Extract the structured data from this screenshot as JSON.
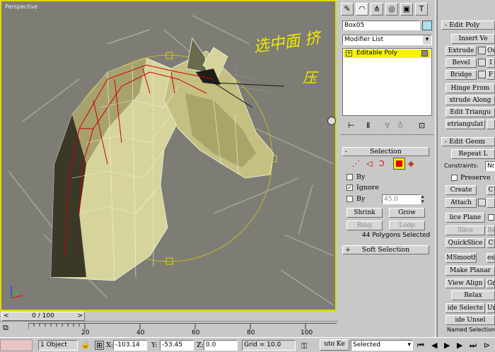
{
  "viewport": {
    "label": "Perspective",
    "annotation_line1": "选中面 挤",
    "annotation_line2": "压"
  },
  "command_panel": {
    "tabs": [
      "create-icon",
      "modify-icon",
      "hierarchy-icon",
      "motion-icon",
      "display-icon",
      "utilities-icon"
    ],
    "object_name": "Box05",
    "modifier_list": "Modifier List",
    "stack_item": "Editable Poly",
    "stack_toolbar_icons": [
      "pin-stack-icon",
      "show-end-result-icon",
      "make-unique-icon",
      "remove-modifier-icon",
      "configure-sets-icon"
    ]
  },
  "selection": {
    "title": "Selection",
    "by_vertex_label": "By",
    "ignore_label": "Ignore",
    "by_angle_label": "By",
    "angle_value": "45.0",
    "shrink": "Shrink",
    "grow": "Grow",
    "ring": "Ring",
    "loop": "Loop",
    "status": "44 Polygons Selected",
    "soft_selection": "Soft Selection"
  },
  "edit_poly": {
    "title": "Edit Poly",
    "insert": "Insert Ve",
    "extrude": "Extrude",
    "outline": "Ou",
    "bevel": "Bevel",
    "inset": "I",
    "bridge": "Bridge",
    "flip": "F",
    "hinge": "Hinge From",
    "extrude_along": "xtrude Along",
    "edit_tri": "Edit Triangu",
    "retriangulate": "etriangulat"
  },
  "edit_geom": {
    "title": "Edit Geom",
    "repeat": "Repeat L",
    "constraints": "Constraints:",
    "constraints_value": "No",
    "preserve": "Preserve",
    "create": "Create",
    "collapse": "C",
    "attach": "Attach",
    "slice_plane": "lice Plane",
    "slice": "Slice",
    "reset": "Re",
    "quickslice": "QuickSlice",
    "cut": "C",
    "msmooth": "MSmooth",
    "tessellate": "es",
    "make_planar": "Make Planar",
    "view_align": "View Align",
    "grid_align": "Gr",
    "relax": "Relax",
    "hide_selected": "ide Selecte",
    "unhide": "Unl",
    "hide_unselected": "ide Unsel",
    "named_selections": "Named Selections:"
  },
  "timeline": {
    "frame": "0 / 100",
    "ticks": [
      "20",
      "40",
      "60",
      "80",
      "100"
    ]
  },
  "status": {
    "objects": "1 Object",
    "x_label": "X:",
    "x_value": "-103.14",
    "y_label": "Y:",
    "y_value": "-53.45",
    "z_label": "Z:",
    "z_value": "0.0",
    "grid": "Grid = 10.0",
    "auto_key": "uto Ke",
    "selected": "Selected"
  },
  "colors": {
    "viewport_bg": "#7d7d76",
    "active_border": "#e4d800",
    "selection_red": "#cc0000",
    "annotation": "#f0e800"
  }
}
